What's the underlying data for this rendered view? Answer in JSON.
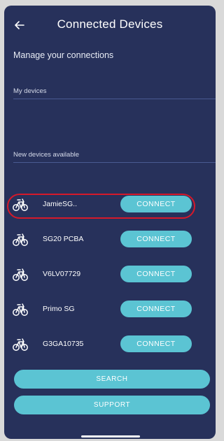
{
  "header": {
    "title": "Connected Devices",
    "back_icon": "arrow-left-icon"
  },
  "subtitle": "Manage your connections",
  "sections": {
    "my_devices": "My devices",
    "new_devices": "New devices available"
  },
  "devices": [
    {
      "name": "JamieSG..",
      "action": "CONNECT",
      "icon": "bicycle-icon",
      "highlighted": true
    },
    {
      "name": "SG20 PCBA",
      "action": "CONNECT",
      "icon": "bicycle-icon"
    },
    {
      "name": "V6LV07729",
      "action": "CONNECT",
      "icon": "bicycle-icon"
    },
    {
      "name": "Primo SG",
      "action": "CONNECT",
      "icon": "bicycle-icon"
    },
    {
      "name": "G3GA10735",
      "action": "CONNECT",
      "icon": "bicycle-icon"
    }
  ],
  "buttons": {
    "search": "SEARCH",
    "support": "SUPPORT"
  },
  "colors": {
    "background": "#27315b",
    "accent": "#5bc4d3",
    "highlight": "#d6192a",
    "divider": "#4a5a92"
  }
}
